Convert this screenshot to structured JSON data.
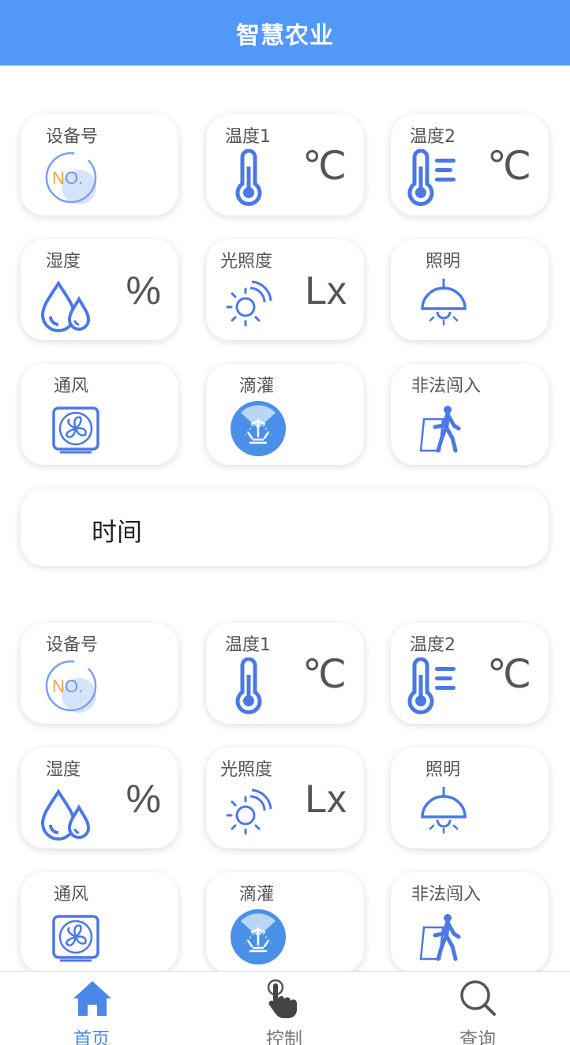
{
  "header": {
    "title": "智慧农业"
  },
  "units": {
    "celsius": "℃",
    "percent": "%",
    "lux": "Lx"
  },
  "device_groups": [
    {
      "cards": {
        "device_no": {
          "label": "设备号",
          "icon": "no-badge-icon"
        },
        "temp1": {
          "label": "温度1",
          "icon": "thermometer-icon"
        },
        "temp2": {
          "label": "温度2",
          "icon": "thermometer-lines-icon"
        },
        "humidity": {
          "label": "湿度",
          "icon": "water-drops-icon"
        },
        "light_level": {
          "label": "光照度",
          "icon": "sun-icon"
        },
        "lighting": {
          "label": "照明",
          "icon": "ceiling-lamp-icon"
        },
        "ventilation": {
          "label": "通风",
          "icon": "fan-icon"
        },
        "drip": {
          "label": "滴灌",
          "icon": "sprinkler-icon"
        },
        "intrusion": {
          "label": "非法闯入",
          "icon": "walking-person-icon"
        }
      },
      "time_label": "时间"
    },
    {
      "cards": {
        "device_no": {
          "label": "设备号",
          "icon": "no-badge-icon"
        },
        "temp1": {
          "label": "温度1",
          "icon": "thermometer-icon"
        },
        "temp2": {
          "label": "温度2",
          "icon": "thermometer-lines-icon"
        },
        "humidity": {
          "label": "湿度",
          "icon": "water-drops-icon"
        },
        "light_level": {
          "label": "光照度",
          "icon": "sun-icon"
        },
        "lighting": {
          "label": "照明",
          "icon": "ceiling-lamp-icon"
        },
        "ventilation": {
          "label": "通风",
          "icon": "fan-icon"
        },
        "drip": {
          "label": "滴灌",
          "icon": "sprinkler-icon"
        },
        "intrusion": {
          "label": "非法闯入",
          "icon": "walking-person-icon"
        }
      }
    }
  ],
  "tabbar": {
    "active": "home",
    "tabs": [
      {
        "key": "home",
        "label": "首页",
        "icon": "home-icon"
      },
      {
        "key": "control",
        "label": "控制",
        "icon": "hand-pointer-icon"
      },
      {
        "key": "query",
        "label": "查询",
        "icon": "search-icon"
      }
    ]
  },
  "colors": {
    "header": "#5198f8",
    "icon_blue": "#4a78e6",
    "active_tab": "#4b86e8",
    "text_gray": "#555555"
  }
}
